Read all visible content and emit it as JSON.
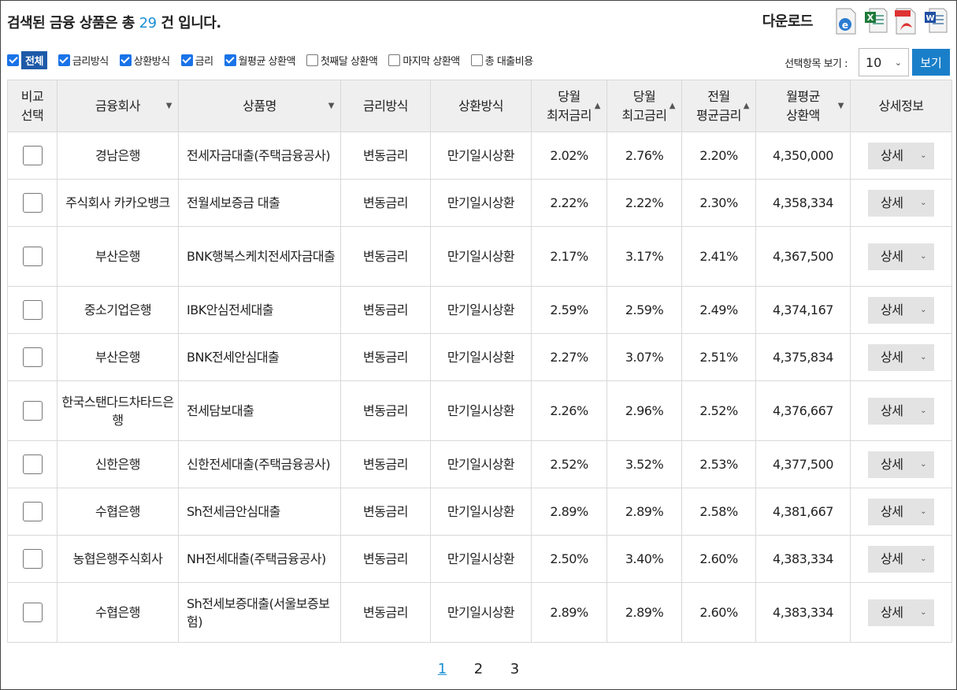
{
  "header": {
    "prefix": "검색된 금융 상품은 총",
    "count": "29",
    "suffix": "건 입니다."
  },
  "download": {
    "label": "다운로드",
    "icons": [
      "ie-icon",
      "excel-icon",
      "pdf-icon",
      "word-icon"
    ]
  },
  "filters": [
    {
      "label": "전체",
      "checked": true
    },
    {
      "label": "금리방식",
      "checked": true
    },
    {
      "label": "상환방식",
      "checked": true
    },
    {
      "label": "금리",
      "checked": true
    },
    {
      "label": "월평균 상환액",
      "checked": true
    },
    {
      "label": "첫째달 상환액",
      "checked": false
    },
    {
      "label": "마지막 상환액",
      "checked": false
    },
    {
      "label": "총 대출비용",
      "checked": false
    }
  ],
  "view": {
    "label": "선택항목 보기 :",
    "selected": "10",
    "button": "보기"
  },
  "columns": [
    {
      "l1": "비교",
      "l2": "선택",
      "sort": ""
    },
    {
      "l1": "금융회사",
      "l2": "",
      "sort": "▼"
    },
    {
      "l1": "상품명",
      "l2": "",
      "sort": "▼"
    },
    {
      "l1": "금리방식",
      "l2": "",
      "sort": ""
    },
    {
      "l1": "상환방식",
      "l2": "",
      "sort": ""
    },
    {
      "l1": "당월",
      "l2": "최저금리",
      "sort": "▲"
    },
    {
      "l1": "당월",
      "l2": "최고금리",
      "sort": "▲"
    },
    {
      "l1": "전월",
      "l2": "평균금리",
      "sort": "▲"
    },
    {
      "l1": "월평균",
      "l2": "상환액",
      "sort": "▼"
    },
    {
      "l1": "상세정보",
      "l2": "",
      "sort": ""
    }
  ],
  "rows": [
    {
      "company": "경남은행",
      "product": "전세자금대출(주택금융공사)",
      "rate_type": "변동금리",
      "repay": "만기일시상환",
      "min": "2.02%",
      "max": "2.76%",
      "avg": "2.20%",
      "monthly": "4,350,000",
      "detail": "상세"
    },
    {
      "company": "주식회사 카카오뱅크",
      "product": "전월세보증금 대출",
      "rate_type": "변동금리",
      "repay": "만기일시상환",
      "min": "2.22%",
      "max": "2.22%",
      "avg": "2.30%",
      "monthly": "4,358,334",
      "detail": "상세"
    },
    {
      "company": "부산은행",
      "product": "BNK행복스케치전세자금대출",
      "rate_type": "변동금리",
      "repay": "만기일시상환",
      "min": "2.17%",
      "max": "3.17%",
      "avg": "2.41%",
      "monthly": "4,367,500",
      "detail": "상세"
    },
    {
      "company": "중소기업은행",
      "product": "IBK안심전세대출",
      "rate_type": "변동금리",
      "repay": "만기일시상환",
      "min": "2.59%",
      "max": "2.59%",
      "avg": "2.49%",
      "monthly": "4,374,167",
      "detail": "상세"
    },
    {
      "company": "부산은행",
      "product": "BNK전세안심대출",
      "rate_type": "변동금리",
      "repay": "만기일시상환",
      "min": "2.27%",
      "max": "3.07%",
      "avg": "2.51%",
      "monthly": "4,375,834",
      "detail": "상세"
    },
    {
      "company": "한국스탠다드차타드은행",
      "product": "전세담보대출",
      "rate_type": "변동금리",
      "repay": "만기일시상환",
      "min": "2.26%",
      "max": "2.96%",
      "avg": "2.52%",
      "monthly": "4,376,667",
      "detail": "상세"
    },
    {
      "company": "신한은행",
      "product": "신한전세대출(주택금융공사)",
      "rate_type": "변동금리",
      "repay": "만기일시상환",
      "min": "2.52%",
      "max": "3.52%",
      "avg": "2.53%",
      "monthly": "4,377,500",
      "detail": "상세"
    },
    {
      "company": "수협은행",
      "product": "Sh전세금안심대출",
      "rate_type": "변동금리",
      "repay": "만기일시상환",
      "min": "2.89%",
      "max": "2.89%",
      "avg": "2.58%",
      "monthly": "4,381,667",
      "detail": "상세"
    },
    {
      "company": "농협은행주식회사",
      "product": "NH전세대출(주택금융공사)",
      "rate_type": "변동금리",
      "repay": "만기일시상환",
      "min": "2.50%",
      "max": "3.40%",
      "avg": "2.60%",
      "monthly": "4,383,334",
      "detail": "상세"
    },
    {
      "company": "수협은행",
      "product": "Sh전세보증대출(서울보증보험)",
      "rate_type": "변동금리",
      "repay": "만기일시상환",
      "min": "2.89%",
      "max": "2.89%",
      "avg": "2.60%",
      "monthly": "4,383,334",
      "detail": "상세"
    }
  ],
  "pagination": {
    "pages": [
      "1",
      "2",
      "3"
    ],
    "current": "1"
  },
  "colors": {
    "accent": "#1a8fd4",
    "button": "#1a7fc9",
    "badge": "#1e5aa8",
    "header_bg": "#efefef"
  }
}
